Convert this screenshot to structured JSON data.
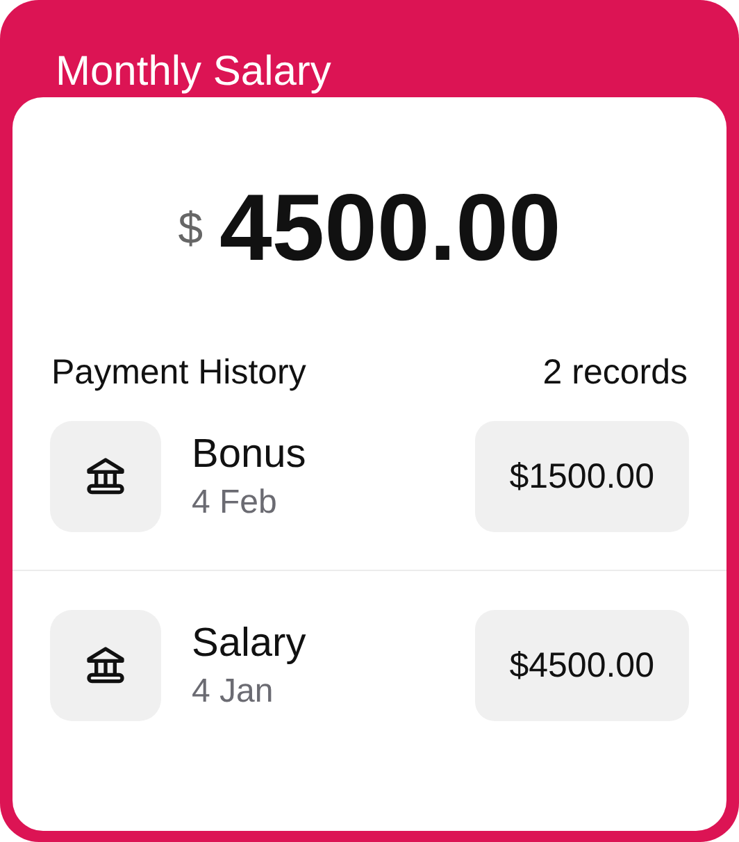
{
  "header": {
    "title": "Monthly Salary"
  },
  "balance": {
    "currency": "$",
    "amount": "4500.00"
  },
  "history": {
    "title": "Payment History",
    "count": "2 records"
  },
  "payments": [
    {
      "name": "Bonus",
      "date": "4 Feb",
      "amount": "$1500.00"
    },
    {
      "name": "Salary",
      "date": "4 Jan",
      "amount": "$4500.00"
    }
  ]
}
